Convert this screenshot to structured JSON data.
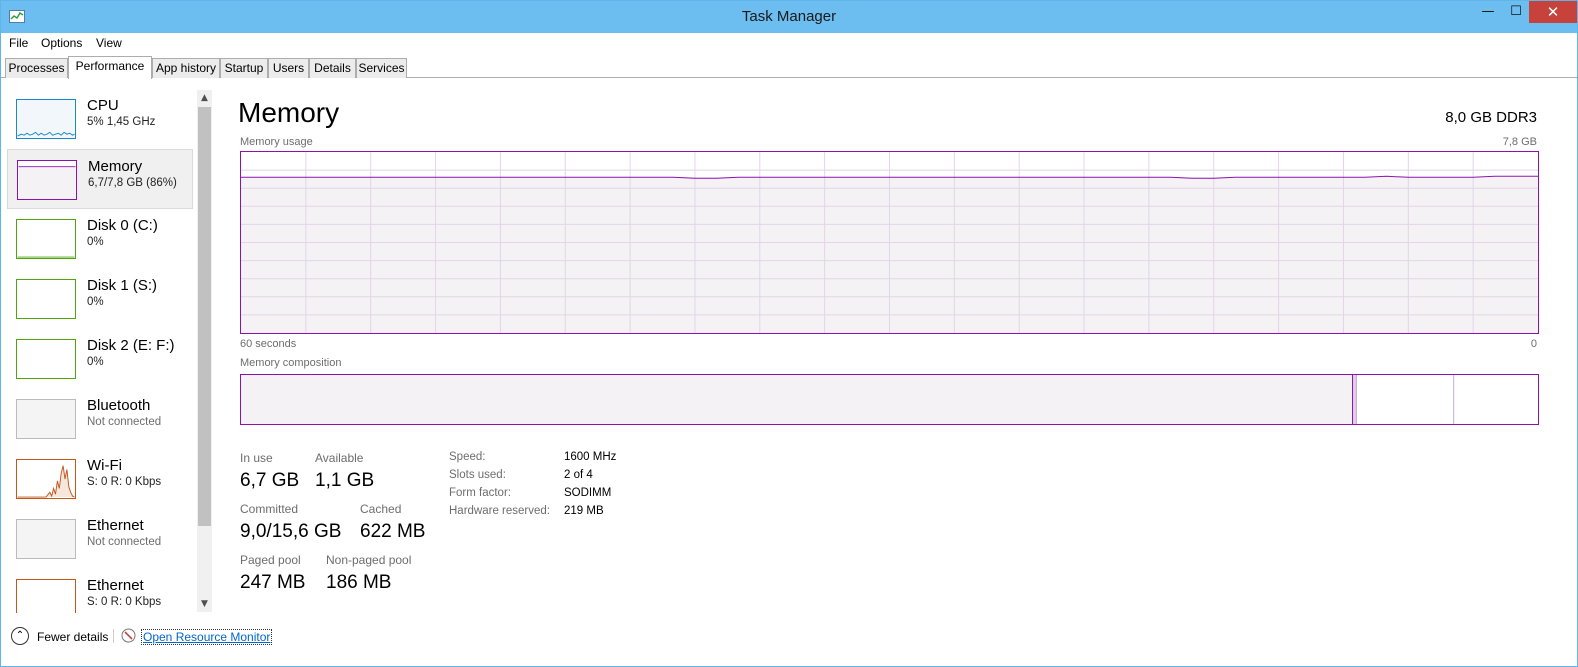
{
  "window": {
    "title": "Task Manager",
    "min_glyph": "—",
    "max_glyph": "☐",
    "close_glyph": "✕"
  },
  "menu": [
    "File",
    "Options",
    "View"
  ],
  "tabs": [
    "Processes",
    "Performance",
    "App history",
    "Startup",
    "Users",
    "Details",
    "Services"
  ],
  "active_tab": "Performance",
  "sidebar": [
    {
      "name": "CPU",
      "sub": "5%  1,45 GHz",
      "color": "#1a87c9"
    },
    {
      "name": "Memory",
      "sub": "6,7/7,8 GB (86%)",
      "color": "#8b12ae"
    },
    {
      "name": "Disk 0 (C:)",
      "sub": "0%",
      "color": "#4da60c"
    },
    {
      "name": "Disk 1 (S:)",
      "sub": "0%",
      "color": "#4da60c"
    },
    {
      "name": "Disk 2 (E: F:)",
      "sub": "0%",
      "color": "#4da60c"
    },
    {
      "name": "Bluetooth",
      "sub": "Not connected",
      "color": "#aaaaaa"
    },
    {
      "name": "Wi-Fi",
      "sub": "S: 0 R: 0 Kbps",
      "color": "#c2571a"
    },
    {
      "name": "Ethernet",
      "sub": "Not connected",
      "color": "#aaaaaa"
    },
    {
      "name": "Ethernet",
      "sub": "S: 0 R: 0 Kbps",
      "color": "#c2571a"
    }
  ],
  "selected_index": 1,
  "main": {
    "title": "Memory",
    "spec": "8,0 GB DDR3",
    "usage_label": "Memory usage",
    "usage_max": "7,8 GB",
    "time_left": "60 seconds",
    "time_right": "0",
    "composition_label": "Memory composition",
    "accent": "#8b12ae"
  },
  "usage_fraction": 0.86,
  "composition": {
    "in_use_fraction": 0.857,
    "modified_fraction": 0.003,
    "standby_fraction": 0.075
  },
  "stats": {
    "in_use": {
      "label": "In use",
      "value": "6,7 GB"
    },
    "available": {
      "label": "Available",
      "value": "1,1 GB"
    },
    "committed": {
      "label": "Committed",
      "value": "9,0/15,6 GB"
    },
    "cached": {
      "label": "Cached",
      "value": "622 MB"
    },
    "paged": {
      "label": "Paged pool",
      "value": "247 MB"
    },
    "nonpaged": {
      "label": "Non-paged pool",
      "value": "186 MB"
    }
  },
  "specs": [
    {
      "k": "Speed:",
      "v": "1600 MHz"
    },
    {
      "k": "Slots used:",
      "v": "2 of 4"
    },
    {
      "k": "Form factor:",
      "v": "SODIMM"
    },
    {
      "k": "Hardware reserved:",
      "v": "219 MB"
    }
  ],
  "footer": {
    "fewer": "Fewer details",
    "resource_monitor": "Open Resource Monitor"
  }
}
